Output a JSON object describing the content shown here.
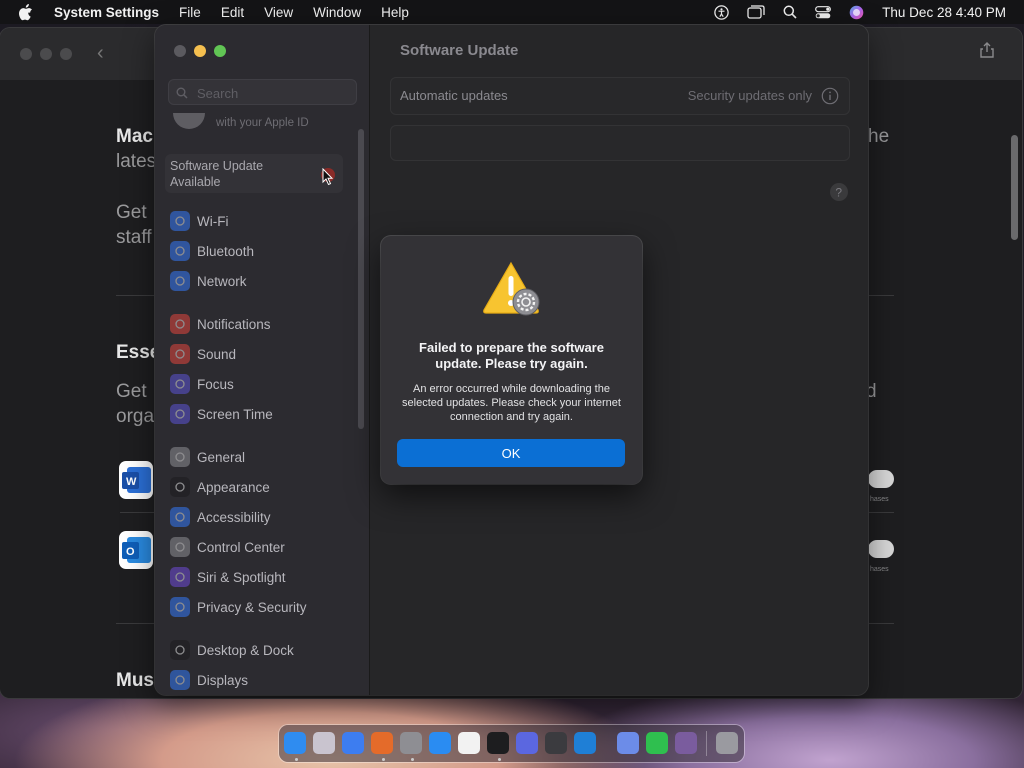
{
  "menubar": {
    "app_name": "System Settings",
    "items": [
      "File",
      "Edit",
      "View",
      "Window",
      "Help"
    ],
    "clock": "Thu Dec 28  4:40 PM"
  },
  "background_window": {
    "fragments": [
      "Mac",
      "lates",
      "Get",
      "staff",
      "Esse",
      "Get",
      "orga",
      "Mus",
      "he",
      "d"
    ],
    "tiny_labels": [
      "hases",
      "hases"
    ]
  },
  "sidebar": {
    "search_placeholder": "Search",
    "profile_subtitle": "with your Apple ID",
    "update_label": "Software Update Available",
    "update_badge": "1",
    "groups": [
      [
        {
          "label": "Wi-Fi",
          "icon": "wifi-icon",
          "color": "#3478f6"
        },
        {
          "label": "Bluetooth",
          "icon": "bluetooth-icon",
          "color": "#3478f6"
        },
        {
          "label": "Network",
          "icon": "globe-icon",
          "color": "#3478f6"
        }
      ],
      [
        {
          "label": "Notifications",
          "icon": "bell-icon",
          "color": "#e0463e"
        },
        {
          "label": "Sound",
          "icon": "speaker-icon",
          "color": "#e0463e"
        },
        {
          "label": "Focus",
          "icon": "moon-icon",
          "color": "#5c54d4"
        },
        {
          "label": "Screen Time",
          "icon": "hourglass-icon",
          "color": "#5c54d4"
        }
      ],
      [
        {
          "label": "General",
          "icon": "gear-icon",
          "color": "#8e8e93"
        },
        {
          "label": "Appearance",
          "icon": "appearance-icon",
          "color": "#1c1c1e"
        },
        {
          "label": "Accessibility",
          "icon": "accessibility-icon",
          "color": "#3478f6"
        },
        {
          "label": "Control Center",
          "icon": "control-center-icon",
          "color": "#8e8e93"
        },
        {
          "label": "Siri & Spotlight",
          "icon": "siri-icon",
          "color": "#6e4bd8"
        },
        {
          "label": "Privacy & Security",
          "icon": "hand-icon",
          "color": "#3478f6"
        }
      ],
      [
        {
          "label": "Desktop & Dock",
          "icon": "dock-icon",
          "color": "#1c1c1e"
        },
        {
          "label": "Displays",
          "icon": "sun-icon",
          "color": "#3478f6"
        }
      ]
    ]
  },
  "main": {
    "title": "Software Update",
    "automatic_updates_label": "Automatic updates",
    "automatic_updates_value": "Security updates only"
  },
  "dialog": {
    "headline": "Failed to prepare the software update. Please try again.",
    "message": "An error occurred while downloading the selected updates. Please check your internet connection and try again.",
    "ok_label": "OK"
  },
  "dock": {
    "apps": [
      {
        "name": "finder-icon",
        "color": "#2f8cf0"
      },
      {
        "name": "launchpad-icon",
        "color": "#c9c4cf"
      },
      {
        "name": "safari-icon",
        "color": "#3d7df0"
      },
      {
        "name": "firefox-icon",
        "color": "#e46b2a"
      },
      {
        "name": "system-settings-icon",
        "color": "#8e8e93"
      },
      {
        "name": "app-store-icon",
        "color": "#2a8cf2"
      },
      {
        "name": "textedit-icon",
        "color": "#f2f2f2"
      },
      {
        "name": "terminal-icon",
        "color": "#1d1d1f"
      },
      {
        "name": "browser-icon",
        "color": "#5b67e0"
      },
      {
        "name": "paintbrush-icon",
        "color": "#3b3b3f"
      },
      {
        "name": "vscode-icon",
        "color": "#1f7fd6"
      },
      {
        "name": "cloud-app-icon",
        "color": "#6c8ce8"
      },
      {
        "name": "facetime-icon",
        "color": "#2fbf4f"
      },
      {
        "name": "potion-app-icon",
        "color": "#7a5c9e"
      },
      {
        "name": "trash-icon",
        "color": "#9a9aa0"
      }
    ]
  }
}
